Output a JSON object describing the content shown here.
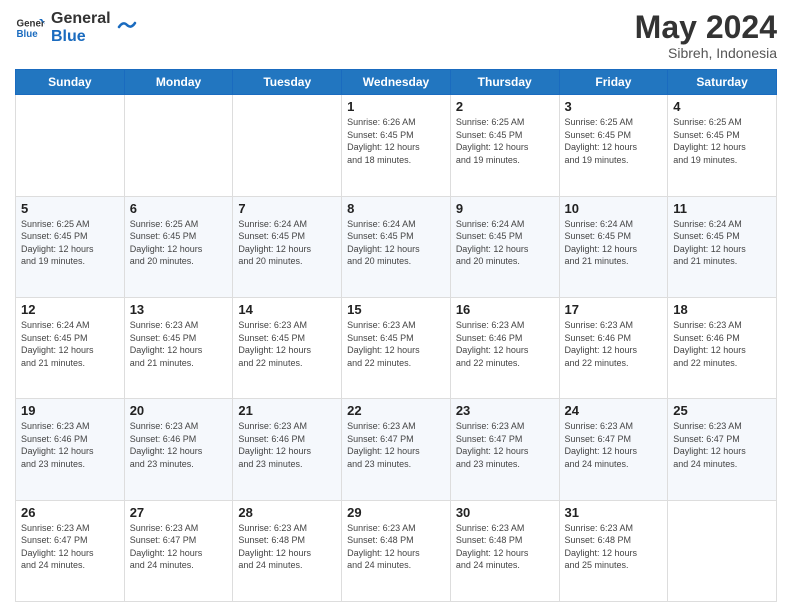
{
  "header": {
    "logo_line1": "General",
    "logo_line2": "Blue",
    "month_year": "May 2024",
    "location": "Sibreh, Indonesia"
  },
  "days_of_week": [
    "Sunday",
    "Monday",
    "Tuesday",
    "Wednesday",
    "Thursday",
    "Friday",
    "Saturday"
  ],
  "weeks": [
    [
      {
        "day": "",
        "info": ""
      },
      {
        "day": "",
        "info": ""
      },
      {
        "day": "",
        "info": ""
      },
      {
        "day": "1",
        "info": "Sunrise: 6:26 AM\nSunset: 6:45 PM\nDaylight: 12 hours\nand 18 minutes."
      },
      {
        "day": "2",
        "info": "Sunrise: 6:25 AM\nSunset: 6:45 PM\nDaylight: 12 hours\nand 19 minutes."
      },
      {
        "day": "3",
        "info": "Sunrise: 6:25 AM\nSunset: 6:45 PM\nDaylight: 12 hours\nand 19 minutes."
      },
      {
        "day": "4",
        "info": "Sunrise: 6:25 AM\nSunset: 6:45 PM\nDaylight: 12 hours\nand 19 minutes."
      }
    ],
    [
      {
        "day": "5",
        "info": "Sunrise: 6:25 AM\nSunset: 6:45 PM\nDaylight: 12 hours\nand 19 minutes."
      },
      {
        "day": "6",
        "info": "Sunrise: 6:25 AM\nSunset: 6:45 PM\nDaylight: 12 hours\nand 20 minutes."
      },
      {
        "day": "7",
        "info": "Sunrise: 6:24 AM\nSunset: 6:45 PM\nDaylight: 12 hours\nand 20 minutes."
      },
      {
        "day": "8",
        "info": "Sunrise: 6:24 AM\nSunset: 6:45 PM\nDaylight: 12 hours\nand 20 minutes."
      },
      {
        "day": "9",
        "info": "Sunrise: 6:24 AM\nSunset: 6:45 PM\nDaylight: 12 hours\nand 20 minutes."
      },
      {
        "day": "10",
        "info": "Sunrise: 6:24 AM\nSunset: 6:45 PM\nDaylight: 12 hours\nand 21 minutes."
      },
      {
        "day": "11",
        "info": "Sunrise: 6:24 AM\nSunset: 6:45 PM\nDaylight: 12 hours\nand 21 minutes."
      }
    ],
    [
      {
        "day": "12",
        "info": "Sunrise: 6:24 AM\nSunset: 6:45 PM\nDaylight: 12 hours\nand 21 minutes."
      },
      {
        "day": "13",
        "info": "Sunrise: 6:23 AM\nSunset: 6:45 PM\nDaylight: 12 hours\nand 21 minutes."
      },
      {
        "day": "14",
        "info": "Sunrise: 6:23 AM\nSunset: 6:45 PM\nDaylight: 12 hours\nand 22 minutes."
      },
      {
        "day": "15",
        "info": "Sunrise: 6:23 AM\nSunset: 6:45 PM\nDaylight: 12 hours\nand 22 minutes."
      },
      {
        "day": "16",
        "info": "Sunrise: 6:23 AM\nSunset: 6:46 PM\nDaylight: 12 hours\nand 22 minutes."
      },
      {
        "day": "17",
        "info": "Sunrise: 6:23 AM\nSunset: 6:46 PM\nDaylight: 12 hours\nand 22 minutes."
      },
      {
        "day": "18",
        "info": "Sunrise: 6:23 AM\nSunset: 6:46 PM\nDaylight: 12 hours\nand 22 minutes."
      }
    ],
    [
      {
        "day": "19",
        "info": "Sunrise: 6:23 AM\nSunset: 6:46 PM\nDaylight: 12 hours\nand 23 minutes."
      },
      {
        "day": "20",
        "info": "Sunrise: 6:23 AM\nSunset: 6:46 PM\nDaylight: 12 hours\nand 23 minutes."
      },
      {
        "day": "21",
        "info": "Sunrise: 6:23 AM\nSunset: 6:46 PM\nDaylight: 12 hours\nand 23 minutes."
      },
      {
        "day": "22",
        "info": "Sunrise: 6:23 AM\nSunset: 6:47 PM\nDaylight: 12 hours\nand 23 minutes."
      },
      {
        "day": "23",
        "info": "Sunrise: 6:23 AM\nSunset: 6:47 PM\nDaylight: 12 hours\nand 23 minutes."
      },
      {
        "day": "24",
        "info": "Sunrise: 6:23 AM\nSunset: 6:47 PM\nDaylight: 12 hours\nand 24 minutes."
      },
      {
        "day": "25",
        "info": "Sunrise: 6:23 AM\nSunset: 6:47 PM\nDaylight: 12 hours\nand 24 minutes."
      }
    ],
    [
      {
        "day": "26",
        "info": "Sunrise: 6:23 AM\nSunset: 6:47 PM\nDaylight: 12 hours\nand 24 minutes."
      },
      {
        "day": "27",
        "info": "Sunrise: 6:23 AM\nSunset: 6:47 PM\nDaylight: 12 hours\nand 24 minutes."
      },
      {
        "day": "28",
        "info": "Sunrise: 6:23 AM\nSunset: 6:48 PM\nDaylight: 12 hours\nand 24 minutes."
      },
      {
        "day": "29",
        "info": "Sunrise: 6:23 AM\nSunset: 6:48 PM\nDaylight: 12 hours\nand 24 minutes."
      },
      {
        "day": "30",
        "info": "Sunrise: 6:23 AM\nSunset: 6:48 PM\nDaylight: 12 hours\nand 24 minutes."
      },
      {
        "day": "31",
        "info": "Sunrise: 6:23 AM\nSunset: 6:48 PM\nDaylight: 12 hours\nand 25 minutes."
      },
      {
        "day": "",
        "info": ""
      }
    ]
  ]
}
